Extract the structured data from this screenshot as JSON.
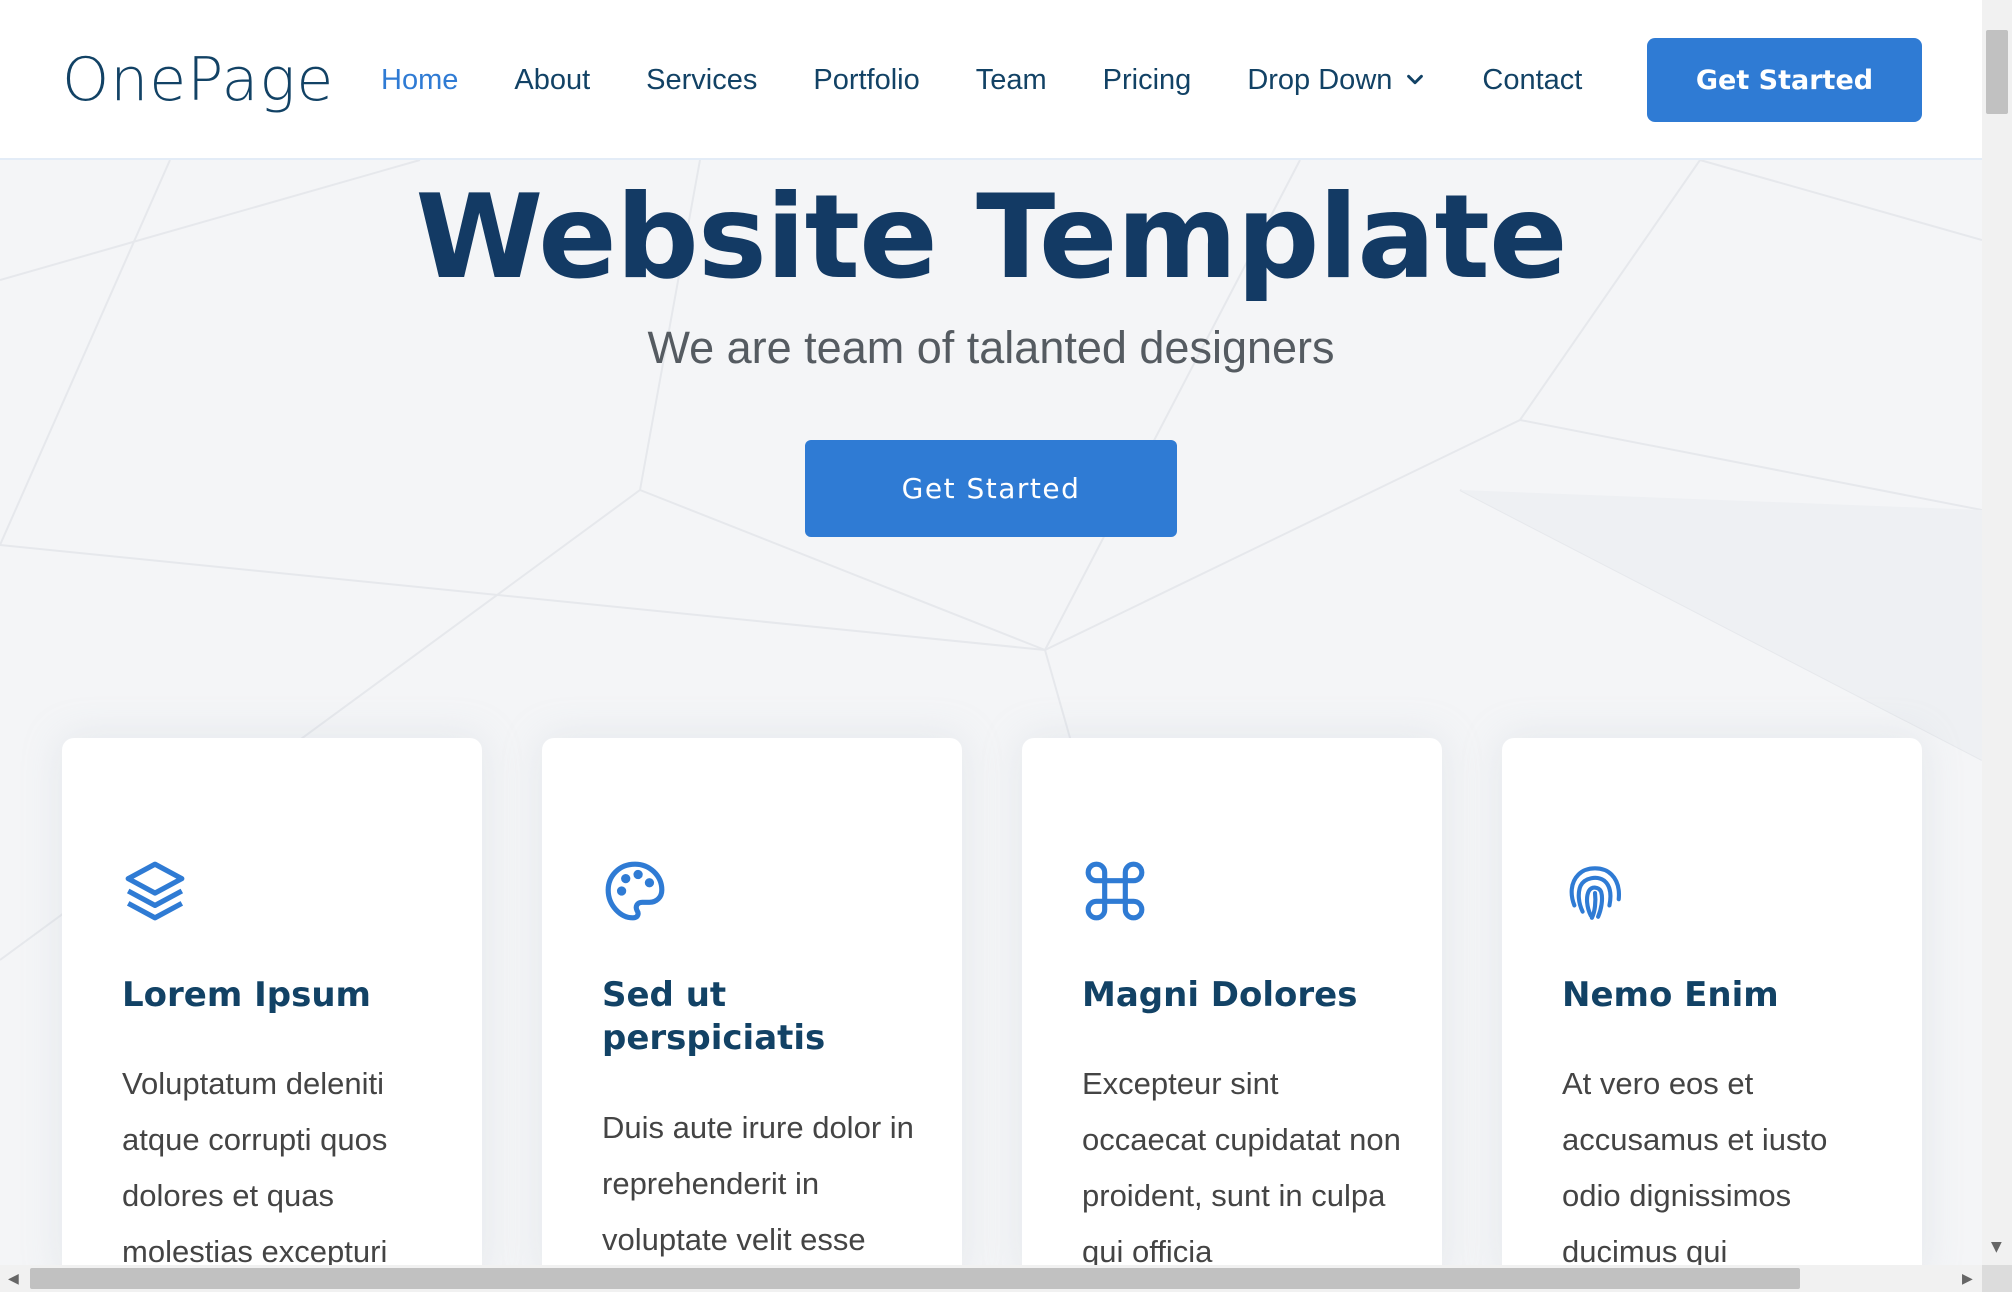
{
  "header": {
    "logo": "OnePage",
    "nav": [
      {
        "label": "Home",
        "active": true
      },
      {
        "label": "About"
      },
      {
        "label": "Services"
      },
      {
        "label": "Portfolio"
      },
      {
        "label": "Team"
      },
      {
        "label": "Pricing"
      },
      {
        "label": "Drop Down",
        "has_dropdown": true
      },
      {
        "label": "Contact"
      }
    ],
    "cta_label": "Get Started"
  },
  "hero": {
    "title": "Website Template",
    "subtitle": "We are team of talanted designers",
    "cta_label": "Get Started"
  },
  "cards": [
    {
      "icon": "layers-icon",
      "title": "Lorem Ipsum",
      "text": "Voluptatum deleniti atque corrupti quos dolores et quas molestias excepturi"
    },
    {
      "icon": "palette-icon",
      "title": "Sed ut perspiciatis",
      "text": "Duis aute irure dolor in reprehenderit in voluptate velit esse"
    },
    {
      "icon": "command-icon",
      "title": "Magni Dolores",
      "text": "Excepteur sint occaecat cupidatat non proident, sunt in culpa qui officia"
    },
    {
      "icon": "fingerprint-icon",
      "title": "Nemo Enim",
      "text": "At vero eos et accusamus et iusto odio dignissimos ducimus qui"
    }
  ],
  "colors": {
    "accent": "#2f7bd4",
    "heading": "#124265",
    "hero_title": "#133a64",
    "text": "#444444"
  }
}
